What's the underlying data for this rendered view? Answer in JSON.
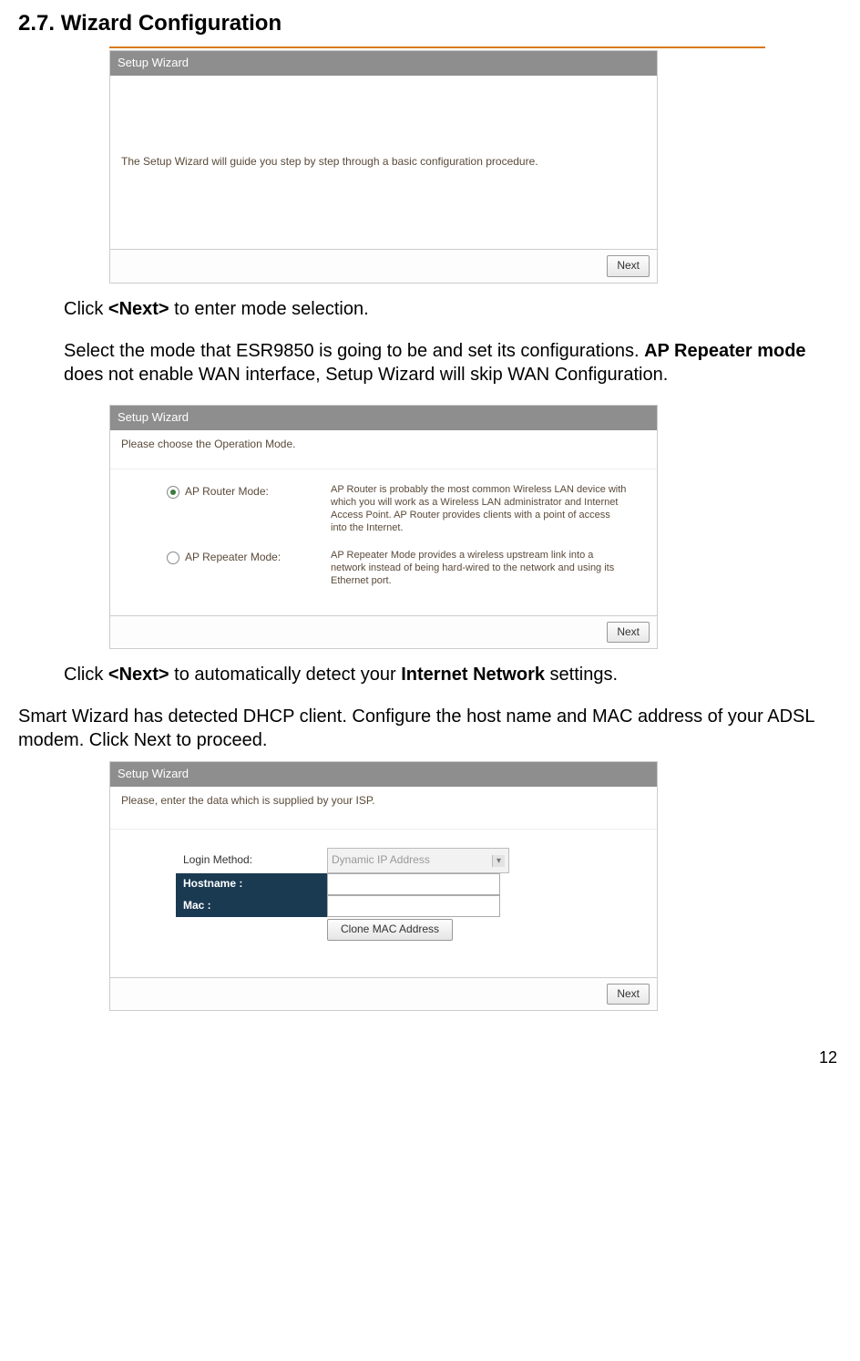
{
  "heading": "2.7. Wizard Configuration",
  "page_number": "12",
  "wizard1": {
    "title": "Setup Wizard",
    "body": "The Setup Wizard will guide you step by step through a basic configuration procedure.",
    "next": "Next"
  },
  "instr1_pre": "Click ",
  "instr1_bold": "<Next>",
  "instr1_post": " to enter mode selection.",
  "instr2_pre": "Select the mode that ESR9850 is going to be and set its configurations. ",
  "instr2_bold": "AP Repeater mode",
  "instr2_post": " does not enable WAN interface, Setup Wizard will skip WAN Configuration.",
  "wizard2": {
    "title": "Setup Wizard",
    "prompt": "Please choose the Operation Mode.",
    "modes": [
      {
        "label": "AP Router Mode:",
        "desc": "AP Router is probably the most common Wireless LAN device with which you will work as a Wireless LAN administrator and Internet Access Point. AP Router provides clients with a point of access into the Internet.",
        "checked": true
      },
      {
        "label": "AP Repeater Mode:",
        "desc": "AP Repeater Mode provides a wireless upstream link into a network instead of being hard-wired to the network and using its Ethernet port.",
        "checked": false
      }
    ],
    "next": "Next"
  },
  "instr3_pre": "Click ",
  "instr3_b1": "<Next>",
  "instr3_mid": " to automatically detect your ",
  "instr3_b2": "Internet Network",
  "instr3_post": " settings.",
  "instr4": "Smart Wizard has detected DHCP client. Configure the host name and MAC address of your ADSL modem. Click Next to proceed.",
  "wizard3": {
    "title": "Setup Wizard",
    "prompt": "Please, enter the data which is supplied by your ISP.",
    "login_method_label": "Login Method:",
    "login_method_value": "Dynamic IP Address",
    "hostname_label": "Hostname :",
    "mac_label": "Mac :",
    "clone_btn": "Clone MAC Address",
    "next": "Next"
  }
}
